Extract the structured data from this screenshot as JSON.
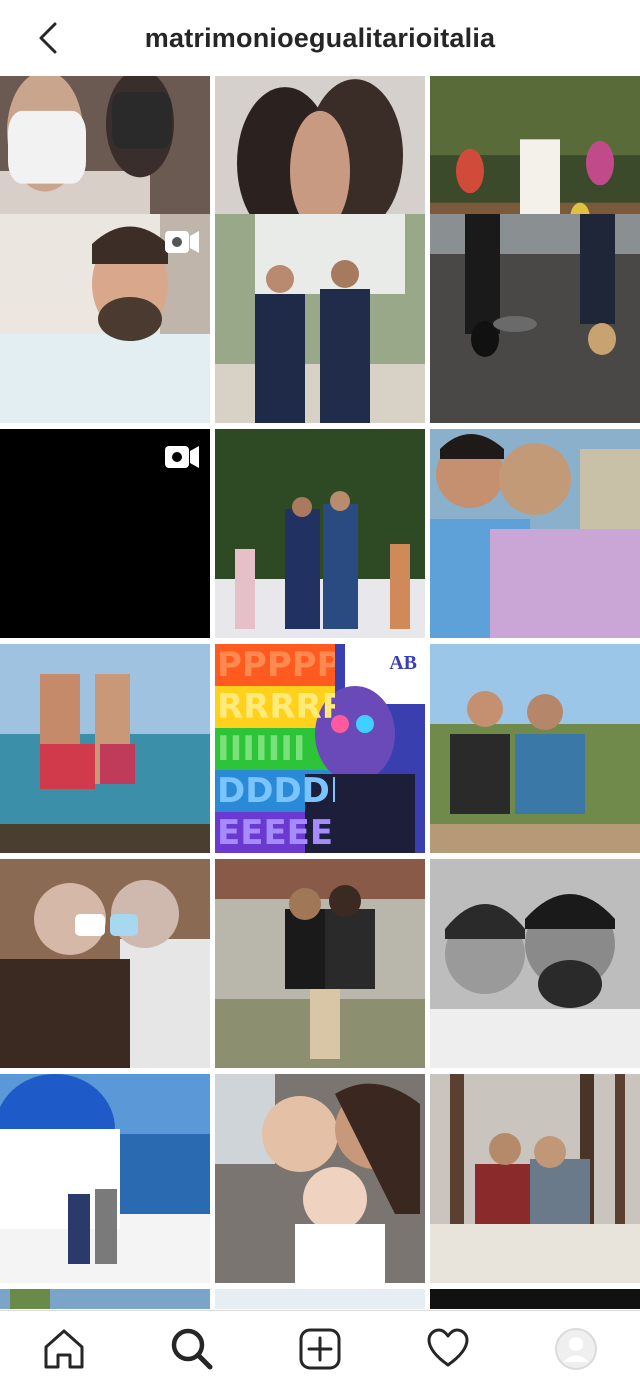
{
  "header": {
    "title": "matrimonioegualitarioitalia"
  },
  "colors": {
    "text": "#262626",
    "divider": "#dbdbdb",
    "background": "#ffffff"
  },
  "posts": [
    {
      "row": 0,
      "col": 0,
      "video": false,
      "desc": "selfie with masks"
    },
    {
      "row": 0,
      "col": 1,
      "video": false,
      "desc": "kiss close-up"
    },
    {
      "row": 0,
      "col": 2,
      "video": false,
      "desc": "wedding crowd"
    },
    {
      "row": 1,
      "col": 0,
      "video": true,
      "desc": "man speaking"
    },
    {
      "row": 1,
      "col": 1,
      "video": false,
      "desc": "grooms walking"
    },
    {
      "row": 1,
      "col": 2,
      "video": false,
      "desc": "legs on train"
    },
    {
      "row": 2,
      "col": 0,
      "video": true,
      "desc": "black video"
    },
    {
      "row": 2,
      "col": 1,
      "video": false,
      "desc": "wedding aisle"
    },
    {
      "row": 2,
      "col": 2,
      "video": false,
      "desc": "kiss floral shirts"
    },
    {
      "row": 3,
      "col": 0,
      "video": false,
      "desc": "beach kiss"
    },
    {
      "row": 3,
      "col": 1,
      "video": false,
      "desc": "pride poster"
    },
    {
      "row": 3,
      "col": 2,
      "video": false,
      "desc": "couple on wall"
    },
    {
      "row": 4,
      "col": 0,
      "video": false,
      "desc": "elderly kiss"
    },
    {
      "row": 4,
      "col": 1,
      "video": false,
      "desc": "women embrace"
    },
    {
      "row": 4,
      "col": 2,
      "video": false,
      "desc": "bw selfie"
    },
    {
      "row": 5,
      "col": 0,
      "video": false,
      "desc": "santorini dome"
    },
    {
      "row": 5,
      "col": 1,
      "video": false,
      "desc": "women with baby"
    },
    {
      "row": 5,
      "col": 2,
      "video": false,
      "desc": "couple in forest"
    }
  ],
  "poster": {
    "logo": "AB",
    "letters": [
      "PPPPPPPP",
      "RRRRRR",
      "IIIIIII",
      "DDDDDD",
      "EEEEE"
    ]
  },
  "tabs": [
    {
      "name": "home",
      "icon": "home-icon"
    },
    {
      "name": "search",
      "icon": "search-icon"
    },
    {
      "name": "create",
      "icon": "plus-square-icon"
    },
    {
      "name": "activity",
      "icon": "heart-icon"
    },
    {
      "name": "profile",
      "icon": "avatar-icon"
    }
  ]
}
